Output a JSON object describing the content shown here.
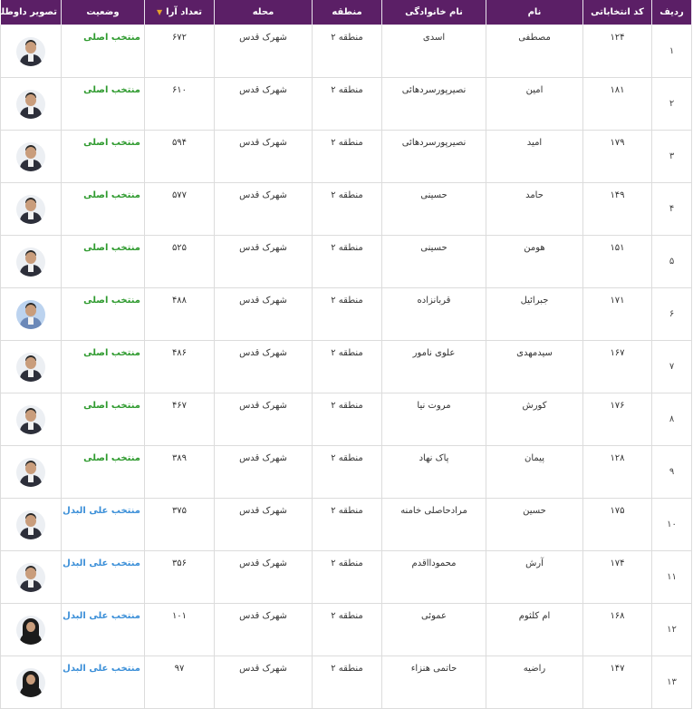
{
  "headers": {
    "row": "ردیف",
    "code": "کد انتخاباتی",
    "first": "نام",
    "last": "نام خانوادگی",
    "region": "منطقه",
    "area": "محله",
    "votes": "تعداد آرا",
    "status": "وضعیت",
    "photo": "تصویر داوطلب"
  },
  "rows": [
    {
      "row": "۱",
      "code": "۱۲۴",
      "first": "مصطفی",
      "last": "اسدی",
      "region": "منطقه ۲",
      "area": "شهرک قدس",
      "votes": "۶۷۲",
      "status": "منتخب اصلی",
      "kind": "main",
      "photo": "male-candidate-photo"
    },
    {
      "row": "۲",
      "code": "۱۸۱",
      "first": "امین",
      "last": "نصیرپورسردهائی",
      "region": "منطقه ۲",
      "area": "شهرک قدس",
      "votes": "۶۱۰",
      "status": "منتخب اصلی",
      "kind": "main",
      "photo": "male-candidate-photo"
    },
    {
      "row": "۳",
      "code": "۱۷۹",
      "first": "امید",
      "last": "نصیرپورسردهائی",
      "region": "منطقه ۲",
      "area": "شهرک قدس",
      "votes": "۵۹۴",
      "status": "منتخب اصلی",
      "kind": "main",
      "photo": "male-candidate-photo"
    },
    {
      "row": "۴",
      "code": "۱۴۹",
      "first": "حامد",
      "last": "حسینی",
      "region": "منطقه ۲",
      "area": "شهرک قدس",
      "votes": "۵۷۷",
      "status": "منتخب اصلی",
      "kind": "main",
      "photo": "male-candidate-photo"
    },
    {
      "row": "۵",
      "code": "۱۵۱",
      "first": "هومن",
      "last": "حسینی",
      "region": "منطقه ۲",
      "area": "شهرک قدس",
      "votes": "۵۲۵",
      "status": "منتخب اصلی",
      "kind": "main",
      "photo": "male-candidate-photo"
    },
    {
      "row": "۶",
      "code": "۱۷۱",
      "first": "جبرائیل",
      "last": "قربانزاده",
      "region": "منطقه ۲",
      "area": "شهرک قدس",
      "votes": "۴۸۸",
      "status": "منتخب اصلی",
      "kind": "main",
      "photo": "male-candidate-photo-blue"
    },
    {
      "row": "۷",
      "code": "۱۶۷",
      "first": "سیدمهدی",
      "last": "علوی نامور",
      "region": "منطقه ۲",
      "area": "شهرک قدس",
      "votes": "۴۸۶",
      "status": "منتخب اصلی",
      "kind": "main",
      "photo": "male-candidate-photo"
    },
    {
      "row": "۸",
      "code": "۱۷۶",
      "first": "کورش",
      "last": "مروت نیا",
      "region": "منطقه ۲",
      "area": "شهرک قدس",
      "votes": "۴۶۷",
      "status": "منتخب اصلی",
      "kind": "main",
      "photo": "male-candidate-photo"
    },
    {
      "row": "۹",
      "code": "۱۲۸",
      "first": "پیمان",
      "last": "پاک نهاد",
      "region": "منطقه ۲",
      "area": "شهرک قدس",
      "votes": "۳۸۹",
      "status": "منتخب اصلی",
      "kind": "main",
      "photo": "male-candidate-photo"
    },
    {
      "row": "۱۰",
      "code": "۱۷۵",
      "first": "حسین",
      "last": "مرادحاصلی خامنه",
      "region": "منطقه ۲",
      "area": "شهرک قدس",
      "votes": "۳۷۵",
      "status": "منتخب علی البدل",
      "kind": "alt",
      "photo": "male-candidate-photo"
    },
    {
      "row": "۱۱",
      "code": "۱۷۴",
      "first": "آرش",
      "last": "محمودااقدم",
      "region": "منطقه ۲",
      "area": "شهرک قدس",
      "votes": "۳۵۶",
      "status": "منتخب علی البدل",
      "kind": "alt",
      "photo": "male-candidate-photo"
    },
    {
      "row": "۱۲",
      "code": "۱۶۸",
      "first": "ام کلثوم",
      "last": "عموئی",
      "region": "منطقه ۲",
      "area": "شهرک قدس",
      "votes": "۱۰۱",
      "status": "منتخب علی البدل",
      "kind": "alt",
      "photo": "female-candidate-photo"
    },
    {
      "row": "۱۳",
      "code": "۱۴۷",
      "first": "راضیه",
      "last": "حاتمی هنزاء",
      "region": "منطقه ۲",
      "area": "شهرک قدس",
      "votes": "۹۷",
      "status": "منتخب علی البدل",
      "kind": "alt",
      "photo": "female-candidate-photo"
    }
  ],
  "colors": {
    "header_bg": "#5b1f66",
    "status_main": "#2e9a2e",
    "status_alt": "#3b8fd8",
    "sort_arrow": "#e5a22b"
  }
}
